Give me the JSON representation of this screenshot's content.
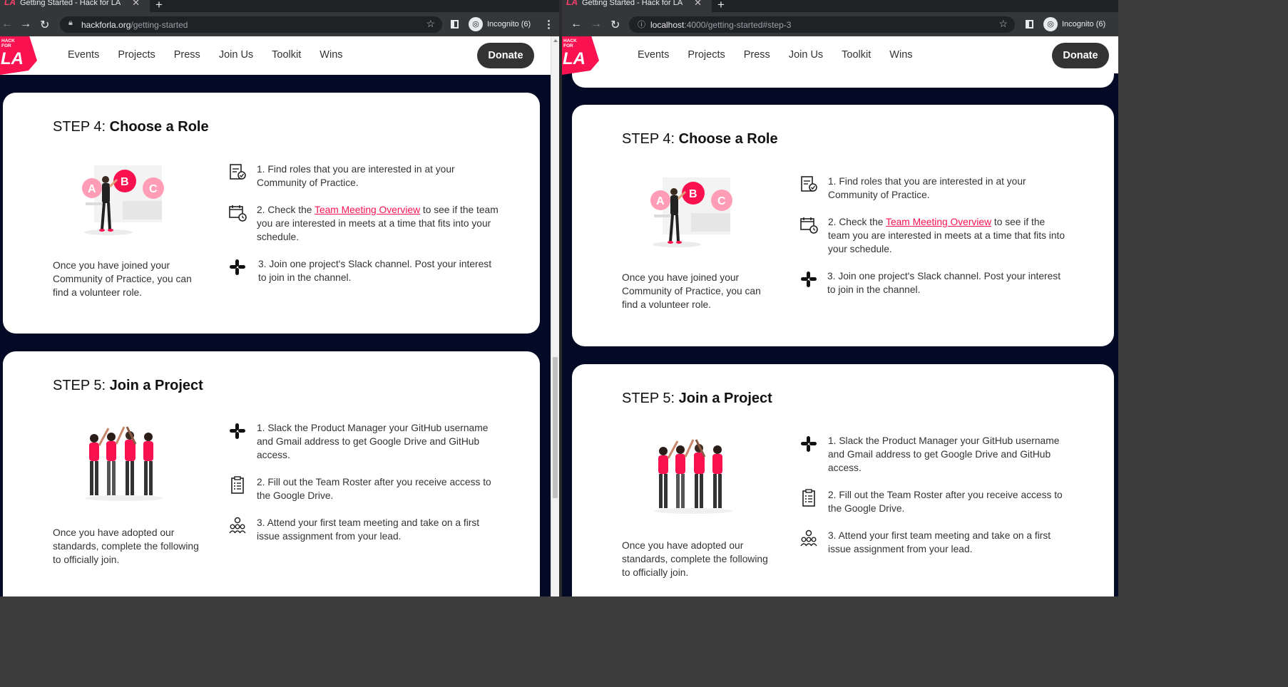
{
  "colors": {
    "accent": "#fa114f",
    "page_bg": "#030a26",
    "donate_bg": "#333333"
  },
  "windows": [
    {
      "tab_title": "Getting Started - Hack for LA",
      "url_host": "hackforla.org",
      "url_path": "/getting-started",
      "incognito_label": "Incognito (6)"
    },
    {
      "tab_title": "Getting Started - Hack for LA",
      "url_host": "localhost",
      "url_path": ":4000/getting-started#step-3",
      "incognito_label": "Incognito (6)"
    }
  ],
  "site": {
    "logo_lines": [
      "HACK",
      "FOR",
      "LA"
    ],
    "nav": [
      "Events",
      "Projects",
      "Press",
      "Join Us",
      "Toolkit",
      "Wins"
    ],
    "donate_label": "Donate"
  },
  "step4": {
    "prefix": "STEP 4: ",
    "title": "Choose a Role",
    "description": "Once you have joined your Community of Practice, you can find a volunteer role.",
    "illustration_letters": [
      "A",
      "B",
      "C"
    ],
    "items": [
      {
        "icon": "document-check-icon",
        "text": "1. Find roles that you are interested in at your Community of Practice."
      },
      {
        "icon": "calendar-clock-icon",
        "before": "2. Check the ",
        "link": "Team Meeting Overview",
        "after": " to see if the team you are interested in meets at a time that fits into your schedule."
      },
      {
        "icon": "slack-icon",
        "text": "3. Join one project's Slack channel. Post your interest to join in the channel."
      }
    ]
  },
  "step5": {
    "prefix": "STEP 5: ",
    "title": "Join a Project",
    "description": "Once you have adopted our standards, complete the following to officially join.",
    "items": [
      {
        "icon": "slack-icon",
        "text": "1. Slack the Product Manager your GitHub username and Gmail address to get Google Drive and GitHub access."
      },
      {
        "icon": "clipboard-list-icon",
        "text": "2. Fill out the Team Roster after you receive access to the Google Drive."
      },
      {
        "icon": "team-meeting-icon",
        "text": "3. Attend your first team meeting and take on a first issue assignment from your lead."
      }
    ]
  }
}
